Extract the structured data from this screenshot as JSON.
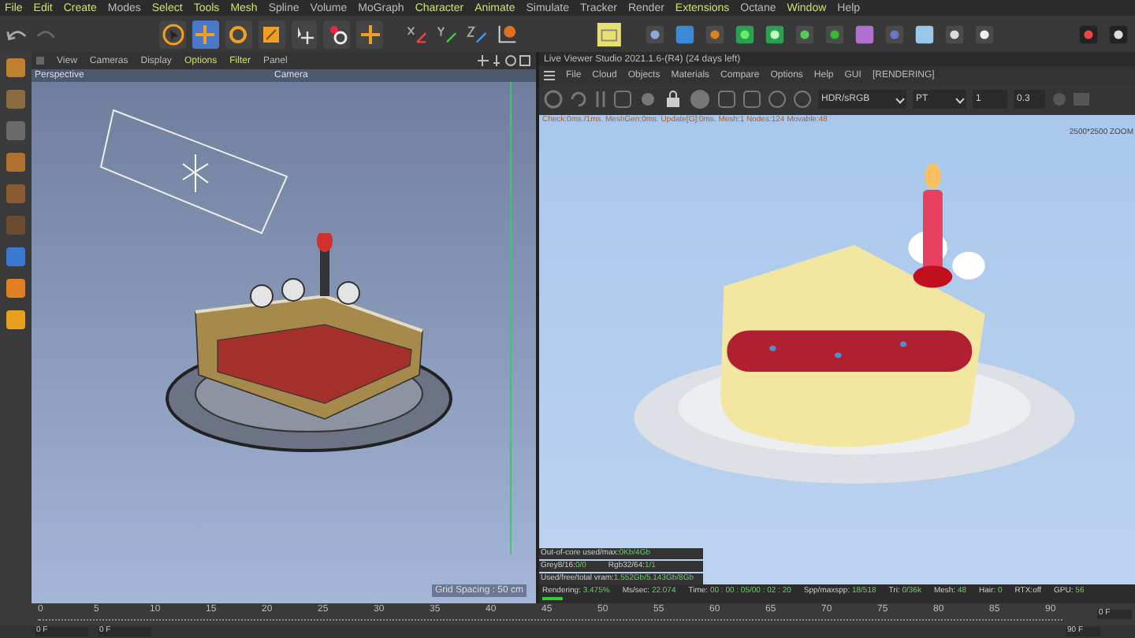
{
  "menu_bar": [
    {
      "label": "File",
      "accent": true
    },
    {
      "label": "Edit",
      "accent": true
    },
    {
      "label": "Create",
      "accent": true
    },
    {
      "label": "Modes",
      "accent": false
    },
    {
      "label": "Select",
      "accent": true
    },
    {
      "label": "Tools",
      "accent": true
    },
    {
      "label": "Mesh",
      "accent": true
    },
    {
      "label": "Spline",
      "accent": false
    },
    {
      "label": "Volume",
      "accent": false
    },
    {
      "label": "MoGraph",
      "accent": false
    },
    {
      "label": "Character",
      "accent": true
    },
    {
      "label": "Animate",
      "accent": true
    },
    {
      "label": "Simulate",
      "accent": false
    },
    {
      "label": "Tracker",
      "accent": false
    },
    {
      "label": "Render",
      "accent": false
    },
    {
      "label": "Extensions",
      "accent": true
    },
    {
      "label": "Octane",
      "accent": false
    },
    {
      "label": "Window",
      "accent": true
    },
    {
      "label": "Help",
      "accent": false
    }
  ],
  "main_tools": [
    {
      "kind": "select",
      "selected": false
    },
    {
      "kind": "move",
      "selected": true
    },
    {
      "kind": "rotate",
      "selected": false
    },
    {
      "kind": "scale",
      "selected": false
    },
    {
      "kind": "transform",
      "selected": false
    },
    {
      "kind": "recent",
      "selected": false
    },
    {
      "kind": "add",
      "selected": false
    }
  ],
  "viewport": {
    "menu": [
      {
        "label": "View",
        "accent": false
      },
      {
        "label": "Cameras",
        "accent": false
      },
      {
        "label": "Display",
        "accent": false
      },
      {
        "label": "Options",
        "accent": true
      },
      {
        "label": "Filter",
        "accent": true
      },
      {
        "label": "Panel",
        "accent": false
      }
    ],
    "projection": "Perspective",
    "camera": "Camera",
    "grid_spacing": "Grid Spacing : 50 cm"
  },
  "live_viewer": {
    "title": "Live Viewer Studio 2021.1.6-(R4) (24 days left)",
    "menu": [
      "File",
      "Cloud",
      "Objects",
      "Materials",
      "Compare",
      "Options",
      "Help",
      "GUI",
      "[RENDERING]"
    ],
    "color_space": "HDR/sRGB",
    "kernel": "PT",
    "field_1": "1",
    "field_2": "0.3",
    "info": "Check:0ms./1ms. MeshGen:0ms. Update[G]:0ms. Mesh:1 Nodes:124 Movable:48",
    "zoom": "2500*2500 ZOOM",
    "stats": [
      [
        {
          "label": "Out-of-core used/max:",
          "value": "0Kb/4Gb"
        }
      ],
      [
        {
          "label": "Grey8/16:",
          "value": "0/0"
        },
        {
          "label": "Rgb32/64:",
          "value": "1/1"
        }
      ],
      [
        {
          "label": "Used/free/total vram:",
          "value": "1.552Gb/5.143Gb/8Gb"
        }
      ]
    ],
    "status": [
      {
        "label": "Rendering:",
        "value": "3.475%"
      },
      {
        "label": "Ms/sec:",
        "value": "22.074"
      },
      {
        "label": "Time:",
        "value": "00 : 00 : 05/00 : 02 : 20"
      },
      {
        "label": "Spp/maxspp:",
        "value": "18/518"
      },
      {
        "label": "Tri:",
        "value": "0/36k"
      },
      {
        "label": "Mesh:",
        "value": "48"
      },
      {
        "label": "Hair:",
        "value": "0"
      },
      {
        "label": "RTX:off"
      },
      {
        "label": "GPU:",
        "value": "56"
      }
    ],
    "progress": {
      "level": 0.035
    }
  },
  "timeline": {
    "ticks": [
      "0",
      "5",
      "10",
      "15",
      "20",
      "25",
      "30",
      "35",
      "40",
      "45",
      "50",
      "55",
      "60",
      "65",
      "70",
      "75",
      "80",
      "85",
      "90"
    ],
    "start_fields": [
      "0 F",
      "0 F"
    ],
    "end_fields": [
      "0 F",
      "90 F"
    ]
  }
}
